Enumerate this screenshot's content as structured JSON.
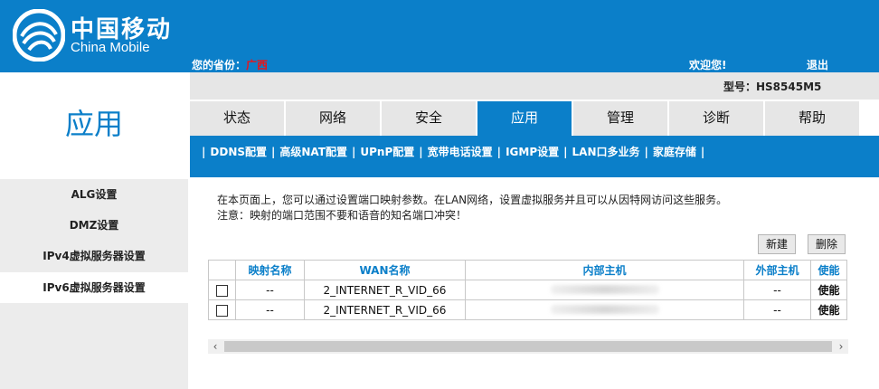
{
  "brand": {
    "name_cn": "中国移动",
    "name_en": "China Mobile"
  },
  "header": {
    "province_label": "您的省份：",
    "province_value": "广西",
    "welcome": "欢迎您!",
    "logout": "退出",
    "model": "型号：HS8545M5"
  },
  "section_title": "应用",
  "sidebar": {
    "items": [
      {
        "label": "ALG设置"
      },
      {
        "label": "DMZ设置"
      },
      {
        "label": "IPv4虚拟服务器设置"
      },
      {
        "label": "IPv6虚拟服务器设置"
      }
    ]
  },
  "tabs": [
    {
      "label": "状态"
    },
    {
      "label": "网络"
    },
    {
      "label": "安全"
    },
    {
      "label": "应用"
    },
    {
      "label": "管理"
    },
    {
      "label": "诊断"
    },
    {
      "label": "帮助"
    }
  ],
  "subnav": [
    {
      "label": "DDNS配置"
    },
    {
      "label": "高级NAT配置"
    },
    {
      "label": "UPnP配置"
    },
    {
      "label": "宽带电话设置"
    },
    {
      "label": "IGMP设置"
    },
    {
      "label": "LAN口多业务"
    },
    {
      "label": "家庭存储"
    }
  ],
  "description": {
    "line1": "在本页面上，您可以通过设置端口映射参数。在LAN网络，设置虚拟服务并且可以从因特网访问这些服务。",
    "line2": "注意：映射的端口范围不要和语音的知名端口冲突！"
  },
  "buttons": {
    "new": "新建",
    "delete": "删除"
  },
  "table": {
    "headers": [
      "",
      "映射名称",
      "WAN名称",
      "内部主机",
      "外部主机",
      "使能"
    ],
    "rows": [
      {
        "name": "--",
        "wan": "2_INTERNET_R_VID_66",
        "external": "--",
        "enable": "使能"
      },
      {
        "name": "--",
        "wan": "2_INTERNET_R_VID_66",
        "external": "--",
        "enable": "使能"
      }
    ]
  },
  "scrollbar": {
    "left": "‹",
    "right": "›"
  }
}
